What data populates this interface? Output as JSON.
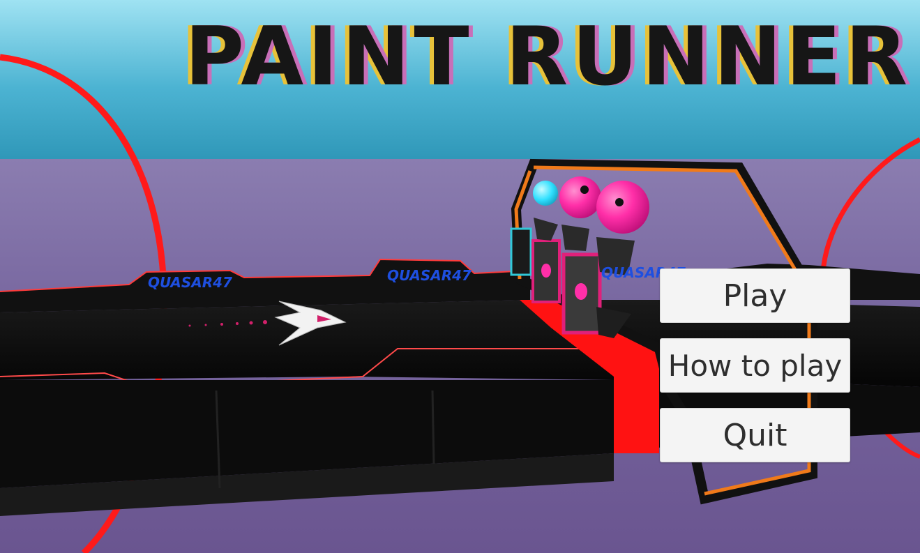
{
  "game": {
    "title": "PAINT RUNNER"
  },
  "signs": [
    {
      "text": "QUASAR47"
    },
    {
      "text": "QUASAR47"
    },
    {
      "text": "QUASAR47"
    }
  ],
  "menu": {
    "play_label": "Play",
    "how_to_play_label": "How to play",
    "quit_label": "Quit"
  },
  "colors": {
    "sky_top": "#8fd8ec",
    "sky_mid": "#3fa8c8",
    "floor": "#6e5a96",
    "track": "#0a0a0a",
    "neon_red": "#ff1a1a",
    "gate_orange": "#f07a1a",
    "pink": "#ff2fa8",
    "cyan": "#30e0ff",
    "sign_blue": "#1e4fe0"
  }
}
